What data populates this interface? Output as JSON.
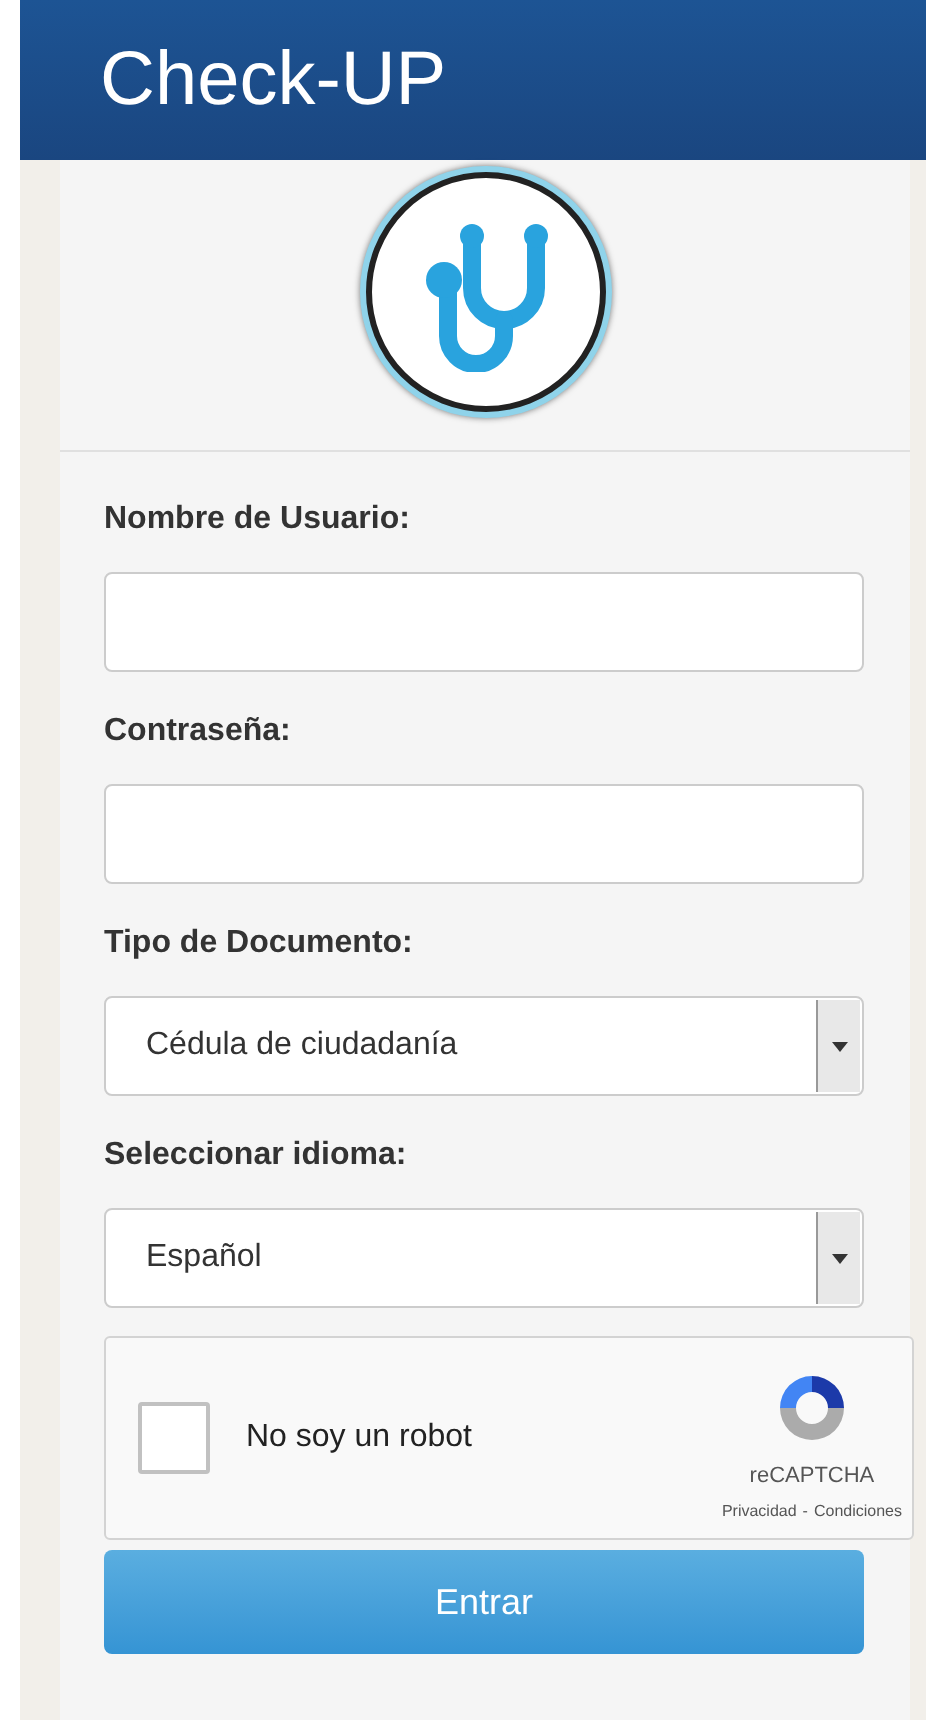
{
  "header": {
    "title": "Check-UP"
  },
  "fields": [
    {
      "kind": "text",
      "label": "Nombre de Usuario:"
    },
    {
      "kind": "text",
      "label": "Contraseña:"
    },
    {
      "kind": "select",
      "label": "Tipo de Documento:",
      "value": "Cédula de ciudadanía"
    },
    {
      "kind": "select",
      "label": "Seleccionar idioma:",
      "value": "Español"
    }
  ],
  "captcha": {
    "checked": false,
    "label": "No soy un robot",
    "brand": "reCAPTCHA",
    "links": [
      "Privacidad",
      "Condiciones"
    ],
    "separator": "-"
  },
  "submit": "Entrar"
}
